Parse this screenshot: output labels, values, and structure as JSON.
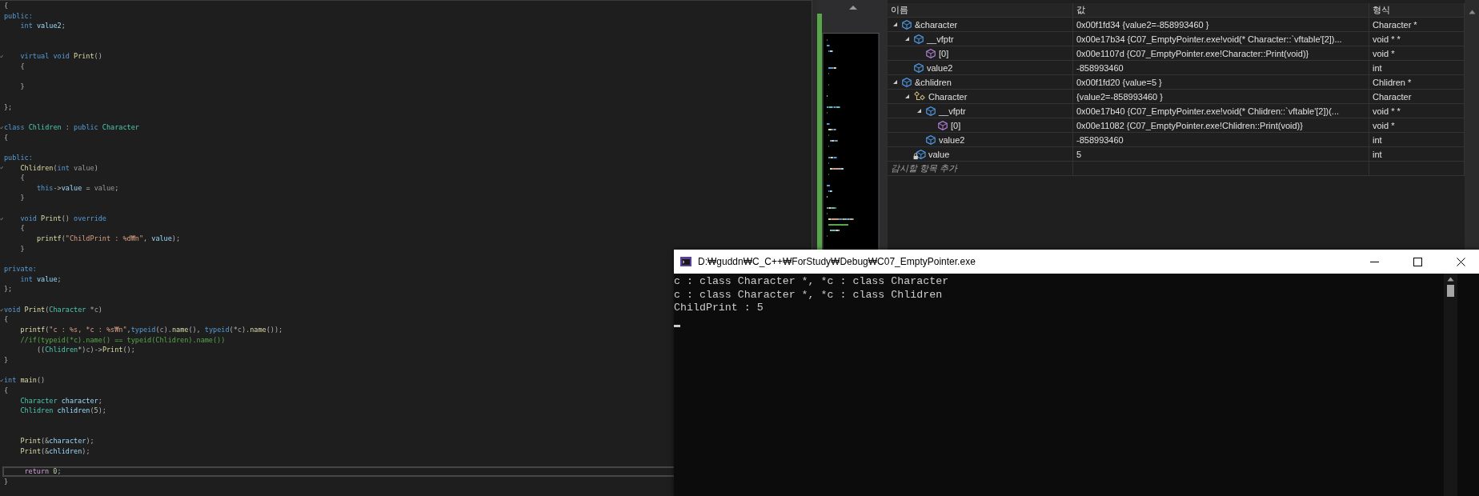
{
  "editor": {
    "lines": [
      {
        "kind": "code",
        "tokens": [
          {
            "kind": "plain",
            "text": "{"
          }
        ]
      },
      {
        "kind": "code",
        "tokens": [
          {
            "kind": "keyword",
            "text": "public:"
          }
        ]
      },
      {
        "kind": "code",
        "tokens": [
          {
            "kind": "keyword",
            "text": "    int"
          },
          {
            "kind": "variable",
            "text": " value2"
          },
          {
            "kind": "plain",
            "text": ";"
          }
        ]
      },
      {
        "kind": "blank"
      },
      {
        "kind": "blank"
      },
      {
        "kind": "code",
        "fold": true,
        "tokens": [
          {
            "kind": "keyword",
            "text": "    virtual void"
          },
          {
            "kind": "function",
            "text": " Print"
          },
          {
            "kind": "plain",
            "text": "()"
          }
        ]
      },
      {
        "kind": "code",
        "tokens": [
          {
            "kind": "plain",
            "text": "    {"
          }
        ]
      },
      {
        "kind": "blank"
      },
      {
        "kind": "code",
        "tokens": [
          {
            "kind": "plain",
            "text": "    }"
          }
        ]
      },
      {
        "kind": "blank"
      },
      {
        "kind": "code",
        "tokens": [
          {
            "kind": "plain",
            "text": "};"
          }
        ]
      },
      {
        "kind": "blank"
      },
      {
        "kind": "code",
        "fold": true,
        "tokens": [
          {
            "kind": "keyword",
            "text": "class"
          },
          {
            "kind": "type",
            "text": " Chlidren"
          },
          {
            "kind": "plain",
            "text": " :"
          },
          {
            "kind": "keyword",
            "text": " public"
          },
          {
            "kind": "type",
            "text": " Character"
          }
        ]
      },
      {
        "kind": "code",
        "tokens": [
          {
            "kind": "plain",
            "text": "{"
          }
        ]
      },
      {
        "kind": "blank"
      },
      {
        "kind": "code",
        "tokens": [
          {
            "kind": "keyword",
            "text": "public:"
          }
        ]
      },
      {
        "kind": "code",
        "fold": true,
        "tokens": [
          {
            "kind": "function",
            "text": "    Chlidren"
          },
          {
            "kind": "plain",
            "text": "("
          },
          {
            "kind": "keyword",
            "text": "int"
          },
          {
            "kind": "parameter",
            "text": " value"
          },
          {
            "kind": "plain",
            "text": ")"
          }
        ]
      },
      {
        "kind": "code",
        "tokens": [
          {
            "kind": "plain",
            "text": "    {"
          }
        ]
      },
      {
        "kind": "code",
        "tokens": [
          {
            "kind": "keyword",
            "text": "        this"
          },
          {
            "kind": "plain",
            "text": "->"
          },
          {
            "kind": "variable",
            "text": "value"
          },
          {
            "kind": "plain",
            "text": " = "
          },
          {
            "kind": "parameter",
            "text": "value"
          },
          {
            "kind": "plain",
            "text": ";"
          }
        ]
      },
      {
        "kind": "code",
        "tokens": [
          {
            "kind": "plain",
            "text": "    }"
          }
        ]
      },
      {
        "kind": "blank"
      },
      {
        "kind": "code",
        "fold": true,
        "tokens": [
          {
            "kind": "keyword",
            "text": "    void"
          },
          {
            "kind": "function",
            "text": " Print"
          },
          {
            "kind": "plain",
            "text": "()"
          },
          {
            "kind": "keyword",
            "text": " override"
          }
        ]
      },
      {
        "kind": "code",
        "tokens": [
          {
            "kind": "plain",
            "text": "    {"
          }
        ]
      },
      {
        "kind": "code",
        "tokens": [
          {
            "kind": "function",
            "text": "        printf"
          },
          {
            "kind": "plain",
            "text": "("
          },
          {
            "kind": "string",
            "text": "\"ChildPrint : %d₩n\""
          },
          {
            "kind": "plain",
            "text": ", "
          },
          {
            "kind": "variable",
            "text": "value"
          },
          {
            "kind": "plain",
            "text": ");"
          }
        ]
      },
      {
        "kind": "code",
        "tokens": [
          {
            "kind": "plain",
            "text": "    }"
          }
        ]
      },
      {
        "kind": "blank"
      },
      {
        "kind": "code",
        "tokens": [
          {
            "kind": "keyword",
            "text": "private:"
          }
        ]
      },
      {
        "kind": "code",
        "tokens": [
          {
            "kind": "keyword",
            "text": "    int"
          },
          {
            "kind": "variable",
            "text": " value"
          },
          {
            "kind": "plain",
            "text": ";"
          }
        ]
      },
      {
        "kind": "code",
        "tokens": [
          {
            "kind": "plain",
            "text": "};"
          }
        ]
      },
      {
        "kind": "blank"
      },
      {
        "kind": "code",
        "fold": true,
        "tokens": [
          {
            "kind": "keyword",
            "text": "void"
          },
          {
            "kind": "function",
            "text": " Print"
          },
          {
            "kind": "plain",
            "text": "("
          },
          {
            "kind": "type",
            "text": "Character"
          },
          {
            "kind": "plain",
            "text": " *"
          },
          {
            "kind": "parameter",
            "text": "c"
          },
          {
            "kind": "plain",
            "text": ")"
          }
        ]
      },
      {
        "kind": "code",
        "tokens": [
          {
            "kind": "plain",
            "text": "{"
          }
        ]
      },
      {
        "kind": "code",
        "tokens": [
          {
            "kind": "function",
            "text": "    printf"
          },
          {
            "kind": "plain",
            "text": "("
          },
          {
            "kind": "string",
            "text": "\"c : %s, *c : %s₩n\""
          },
          {
            "kind": "plain",
            "text": ","
          },
          {
            "kind": "keyword",
            "text": "typeid"
          },
          {
            "kind": "plain",
            "text": "("
          },
          {
            "kind": "parameter",
            "text": "c"
          },
          {
            "kind": "plain",
            "text": ")."
          },
          {
            "kind": "function",
            "text": "name"
          },
          {
            "kind": "plain",
            "text": "(), "
          },
          {
            "kind": "keyword",
            "text": "typeid"
          },
          {
            "kind": "plain",
            "text": "(*"
          },
          {
            "kind": "parameter",
            "text": "c"
          },
          {
            "kind": "plain",
            "text": ")."
          },
          {
            "kind": "function",
            "text": "name"
          },
          {
            "kind": "plain",
            "text": "());"
          }
        ]
      },
      {
        "kind": "code",
        "tokens": [
          {
            "kind": "comment",
            "text": "    //if(typeid(*c).name() == typeid(Chlidren).name())"
          }
        ]
      },
      {
        "kind": "code",
        "tokens": [
          {
            "kind": "plain",
            "text": "        (("
          },
          {
            "kind": "type",
            "text": "Chlidren"
          },
          {
            "kind": "plain",
            "text": "*)"
          },
          {
            "kind": "parameter",
            "text": "c"
          },
          {
            "kind": "plain",
            "text": ")->"
          },
          {
            "kind": "function",
            "text": "Print"
          },
          {
            "kind": "plain",
            "text": "();"
          }
        ]
      },
      {
        "kind": "code",
        "tokens": [
          {
            "kind": "plain",
            "text": "}"
          }
        ]
      },
      {
        "kind": "blank"
      },
      {
        "kind": "code",
        "fold": true,
        "tokens": [
          {
            "kind": "keyword",
            "text": "int"
          },
          {
            "kind": "function",
            "text": " main"
          },
          {
            "kind": "plain",
            "text": "()"
          }
        ]
      },
      {
        "kind": "code",
        "tokens": [
          {
            "kind": "plain",
            "text": "{"
          }
        ]
      },
      {
        "kind": "code",
        "tokens": [
          {
            "kind": "type",
            "text": "    Character"
          },
          {
            "kind": "variable",
            "text": " character"
          },
          {
            "kind": "plain",
            "text": ";"
          }
        ]
      },
      {
        "kind": "code",
        "tokens": [
          {
            "kind": "type",
            "text": "    Chlidren"
          },
          {
            "kind": "variable",
            "text": " chlidren"
          },
          {
            "kind": "plain",
            "text": "("
          },
          {
            "kind": "number",
            "text": "5"
          },
          {
            "kind": "plain",
            "text": ");"
          }
        ]
      },
      {
        "kind": "blank"
      },
      {
        "kind": "blank"
      },
      {
        "kind": "code",
        "tokens": [
          {
            "kind": "function",
            "text": "    Print"
          },
          {
            "kind": "plain",
            "text": "(&"
          },
          {
            "kind": "variable",
            "text": "character"
          },
          {
            "kind": "plain",
            "text": ");"
          }
        ]
      },
      {
        "kind": "code",
        "tokens": [
          {
            "kind": "function",
            "text": "    Print"
          },
          {
            "kind": "plain",
            "text": "(&"
          },
          {
            "kind": "variable",
            "text": "chlidren"
          },
          {
            "kind": "plain",
            "text": ");"
          }
        ]
      },
      {
        "kind": "blank"
      },
      {
        "kind": "code",
        "current": true,
        "tokens": [
          {
            "kind": "control",
            "text": "    return"
          },
          {
            "kind": "number",
            "text": " 0"
          },
          {
            "kind": "plain",
            "text": ";"
          }
        ]
      },
      {
        "kind": "code",
        "tokens": [
          {
            "kind": "plain",
            "text": "}"
          }
        ]
      }
    ]
  },
  "watch": {
    "columns": [
      "이름",
      "값",
      "형식"
    ],
    "rows": [
      {
        "name": "&character",
        "value": "0x00f1fd34 {value2=-858993460 }",
        "type": "Character *",
        "kind": "object",
        "expanded": true,
        "children": [
          {
            "name": "__vfptr",
            "value": "0x00e17b34 {C07_EmptyPointer.exe!void(* Character::`vftable'[2])...",
            "type": "void * *",
            "kind": "object",
            "expanded": true,
            "children": [
              {
                "name": "[0]",
                "value": "0x00e1107d {C07_EmptyPointer.exe!Character::Print(void)}",
                "type": "void *",
                "kind": "method"
              }
            ]
          },
          {
            "name": "value2",
            "value": "-858993460",
            "type": "int",
            "kind": "object"
          }
        ]
      },
      {
        "name": "&chlidren",
        "value": "0x00f1fd20 {value=5 }",
        "type": "Chlidren *",
        "kind": "object",
        "expanded": true,
        "children": [
          {
            "name": "Character",
            "value": "{value2=-858993460 }",
            "type": "Character",
            "kind": "base",
            "expanded": true,
            "children": [
              {
                "name": "__vfptr",
                "value": "0x00e17b40 {C07_EmptyPointer.exe!void(* Chlidren::`vftable'[2])(...",
                "type": "void * *",
                "kind": "object",
                "expanded": true,
                "children": [
                  {
                    "name": "[0]",
                    "value": "0x00e11082 {C07_EmptyPointer.exe!Chlidren::Print(void)}",
                    "type": "void *",
                    "kind": "method"
                  }
                ]
              },
              {
                "name": "value2",
                "value": "-858993460",
                "type": "int",
                "kind": "object"
              }
            ]
          },
          {
            "name": "value",
            "value": "5",
            "type": "int",
            "kind": "private"
          }
        ]
      }
    ],
    "add_placeholder": "감시할 항목 추가"
  },
  "console": {
    "title": "D:₩guddn₩C_C++₩ForStudy₩Debug₩C07_EmptyPointer.exe",
    "lines": [
      "c : class Character *, *c : class Character",
      "c : class Character *, *c : class Chlidren",
      "ChildPrint : 5"
    ]
  }
}
